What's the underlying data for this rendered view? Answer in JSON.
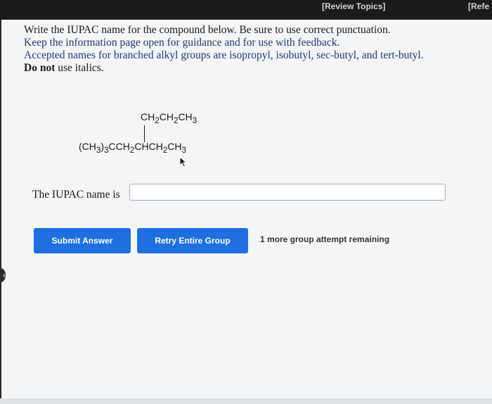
{
  "header": {
    "review_topics": "[Review Topics]",
    "references": "[Refe"
  },
  "instructions": {
    "line1": "Write the IUPAC name for the compound below. Be sure to use correct punctuation.",
    "line2": "Keep the information page open for guidance and for use with feedback.",
    "line3": "Accepted names for branched alkyl groups are isopropyl, isobutyl, sec-butyl, and tert-butyl.",
    "line4_bold": "Do not",
    "line4_rest": " use italics."
  },
  "molecule": {
    "branch_parts": [
      "CH",
      "2",
      "CH",
      "2",
      "CH",
      "3"
    ],
    "main_parts": [
      "(CH",
      "3",
      ")",
      "3",
      "CCH",
      "2",
      "CHCH",
      "2",
      "CH",
      "3"
    ]
  },
  "answer": {
    "label": "The IUPAC name is",
    "value": "",
    "placeholder": ""
  },
  "buttons": {
    "submit": "Submit Answer",
    "retry": "Retry Entire Group"
  },
  "status": {
    "remaining": "1 more group attempt remaining"
  },
  "icons": {
    "cursor": "arrow-cursor-icon",
    "scroll": "chevron-left-icon"
  },
  "colors": {
    "button": "#1f6fe0",
    "topbar": "#1b1b1b",
    "instruction_blue": "#1d3a78"
  }
}
